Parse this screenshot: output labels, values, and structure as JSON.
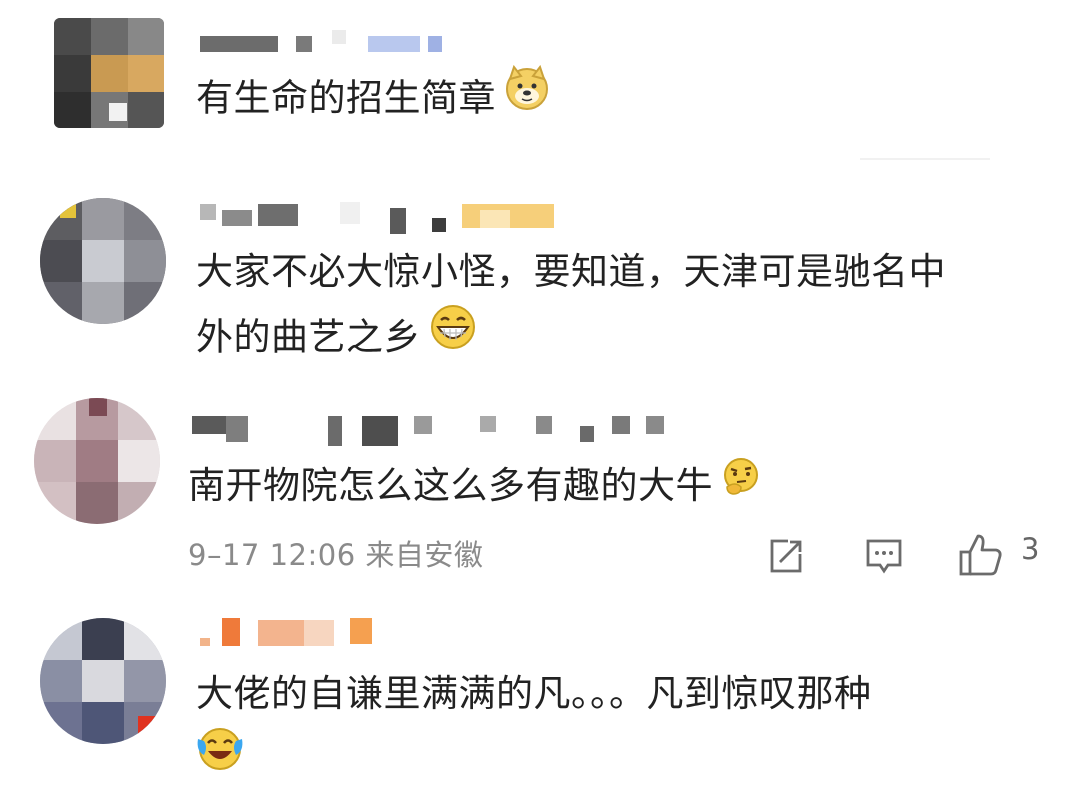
{
  "comments": [
    {
      "text": "有生命的招生简章",
      "emoji": "doge-emoji"
    },
    {
      "text_line1": "大家不必大惊小怪，要知道，天津可是驰名中",
      "text_line2": "外的曲艺之乡",
      "emoji": "grin-emoji"
    },
    {
      "text": "南开物院怎么这么多有趣的大牛",
      "emoji": "thinking-emoji",
      "meta": "9–17 12:06 来自安徽",
      "like_count": "3"
    },
    {
      "text": "大佬的自谦里满满的凡。。。凡到惊叹那种",
      "emoji": "laugh-cry-emoji"
    }
  ]
}
